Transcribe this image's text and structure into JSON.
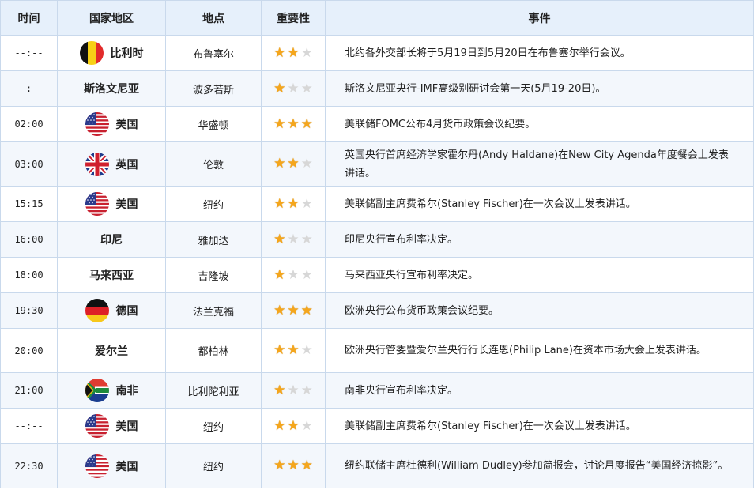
{
  "headers": {
    "time": "时间",
    "country": "国家地区",
    "place": "地点",
    "importance": "重要性",
    "event": "事件"
  },
  "rows": [
    {
      "time": "--:--",
      "country": "比利时",
      "flag": "belgium-flag",
      "place": "布鲁塞尔",
      "stars": 2,
      "event": "北约各外交部长将于5月19日到5月20日在布鲁塞尔举行会议。",
      "highlight": false
    },
    {
      "time": "--:--",
      "country": "斯洛文尼亚",
      "flag": "",
      "place": "波多若斯",
      "stars": 1,
      "event": "斯洛文尼亚央行-IMF高级别研讨会第一天(5月19-20日)。",
      "highlight": false
    },
    {
      "time": "02:00",
      "country": "美国",
      "flag": "usa-flag",
      "place": "华盛顿",
      "stars": 3,
      "event": "美联储FOMC公布4月货币政策会议纪要。",
      "highlight": true
    },
    {
      "time": "03:00",
      "country": "英国",
      "flag": "uk-flag",
      "place": "伦敦",
      "stars": 2,
      "event": "英国央行首席经济学家霍尔丹(Andy Haldane)在New City Agenda年度餐会上发表讲话。",
      "highlight": false
    },
    {
      "time": "15:15",
      "country": "美国",
      "flag": "usa-flag",
      "place": "纽约",
      "stars": 2,
      "event": "美联储副主席费希尔(Stanley Fischer)在一次会议上发表讲话。",
      "highlight": false
    },
    {
      "time": "16:00",
      "country": "印尼",
      "flag": "",
      "place": "雅加达",
      "stars": 1,
      "event": "印尼央行宣布利率决定。",
      "highlight": false
    },
    {
      "time": "18:00",
      "country": "马来西亚",
      "flag": "",
      "place": "吉隆坡",
      "stars": 1,
      "event": "马来西亚央行宣布利率决定。",
      "highlight": false
    },
    {
      "time": "19:30",
      "country": "德国",
      "flag": "germany-flag",
      "place": "法兰克福",
      "stars": 3,
      "event": "欧洲央行公布货币政策会议纪要。",
      "highlight": true
    },
    {
      "time": "20:00",
      "country": "爱尔兰",
      "flag": "",
      "place": "都柏林",
      "stars": 2,
      "event": "欧洲央行管委暨爱尔兰央行行长连恩(Philip Lane)在资本市场大会上发表讲话。",
      "highlight": false
    },
    {
      "time": "21:00",
      "country": "南非",
      "flag": "south-africa-flag",
      "place": "比利陀利亚",
      "stars": 1,
      "event": "南非央行宣布利率决定。",
      "highlight": false
    },
    {
      "time": "--:--",
      "country": "美国",
      "flag": "usa-flag",
      "place": "纽约",
      "stars": 2,
      "event": "美联储副主席费希尔(Stanley Fischer)在一次会议上发表讲话。",
      "highlight": false
    },
    {
      "time": "22:30",
      "country": "美国",
      "flag": "usa-flag",
      "place": "纽约",
      "stars": 3,
      "event": "纽约联储主席杜德利(William Dudley)参加简报会，讨论月度报告“美国经济掠影”。",
      "highlight": true
    }
  ],
  "colors": {
    "highlight_text": "#c5211a",
    "star_on": "#f5a61c",
    "star_off": "#d7d7d7",
    "header_bg": "#e6f0fb",
    "border": "#c9d9ec"
  }
}
